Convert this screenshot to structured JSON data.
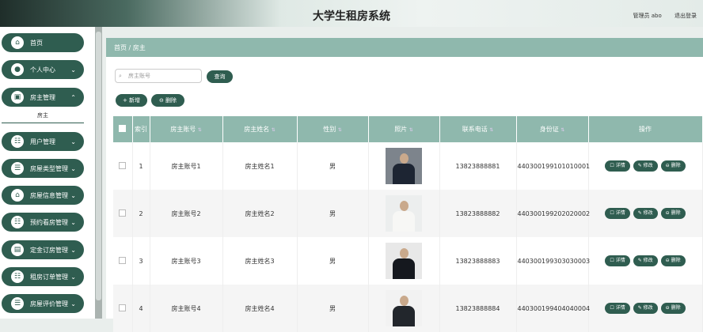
{
  "app_title": "大学生租房系统",
  "top_left": "",
  "header_right": [
    "管理员 abo",
    "退出登录"
  ],
  "sidebar": {
    "items": [
      {
        "label": "首页",
        "icon": "home-icon",
        "glyph": "⌂"
      },
      {
        "label": "个人中心",
        "icon": "user-icon",
        "glyph": "●"
      },
      {
        "label": "房主管理",
        "icon": "folder-icon",
        "glyph": "▣"
      },
      {
        "label": "用户管理",
        "icon": "users-icon",
        "glyph": "☷"
      },
      {
        "label": "房屋类型管理",
        "icon": "list-icon",
        "glyph": "☰"
      },
      {
        "label": "房屋信息管理",
        "icon": "house-icon",
        "glyph": "⌂"
      },
      {
        "label": "预约看房管理",
        "icon": "calendar-icon",
        "glyph": "☷"
      },
      {
        "label": "定金订房管理",
        "icon": "wallet-icon",
        "glyph": "▤"
      },
      {
        "label": "租房订单管理",
        "icon": "order-icon",
        "glyph": "☷"
      },
      {
        "label": "房屋评价管理",
        "icon": "comment-icon",
        "glyph": "☰"
      }
    ],
    "submenu": "房主"
  },
  "breadcrumb": "首页 / 房主",
  "search": {
    "placeholder": "房主账号",
    "button": "查询"
  },
  "actions": {
    "add": "+ 新增",
    "delete": "⊖ 删除"
  },
  "table": {
    "headers": [
      "索引",
      "房主账号",
      "房主姓名",
      "性别",
      "照片",
      "联系电话",
      "身份证",
      "操作"
    ],
    "rows": [
      {
        "index": "1",
        "account": "房主账号1",
        "name": "房主姓名1",
        "gender": "男",
        "phone": "13823888881",
        "idcard": "440300199101010001"
      },
      {
        "index": "2",
        "account": "房主账号2",
        "name": "房主姓名2",
        "gender": "男",
        "phone": "13823888882",
        "idcard": "440300199202020002"
      },
      {
        "index": "3",
        "account": "房主账号3",
        "name": "房主姓名3",
        "gender": "男",
        "phone": "13823888883",
        "idcard": "440300199303030003"
      },
      {
        "index": "4",
        "account": "房主账号4",
        "name": "房主姓名4",
        "gender": "男",
        "phone": "13823888884",
        "idcard": "440300199404040004"
      }
    ],
    "ops": [
      "☐ 详情",
      "✎ 修改",
      "⊖ 删除"
    ]
  },
  "colors": {
    "accent": "#2f5d50",
    "header": "#8fb8ad"
  }
}
